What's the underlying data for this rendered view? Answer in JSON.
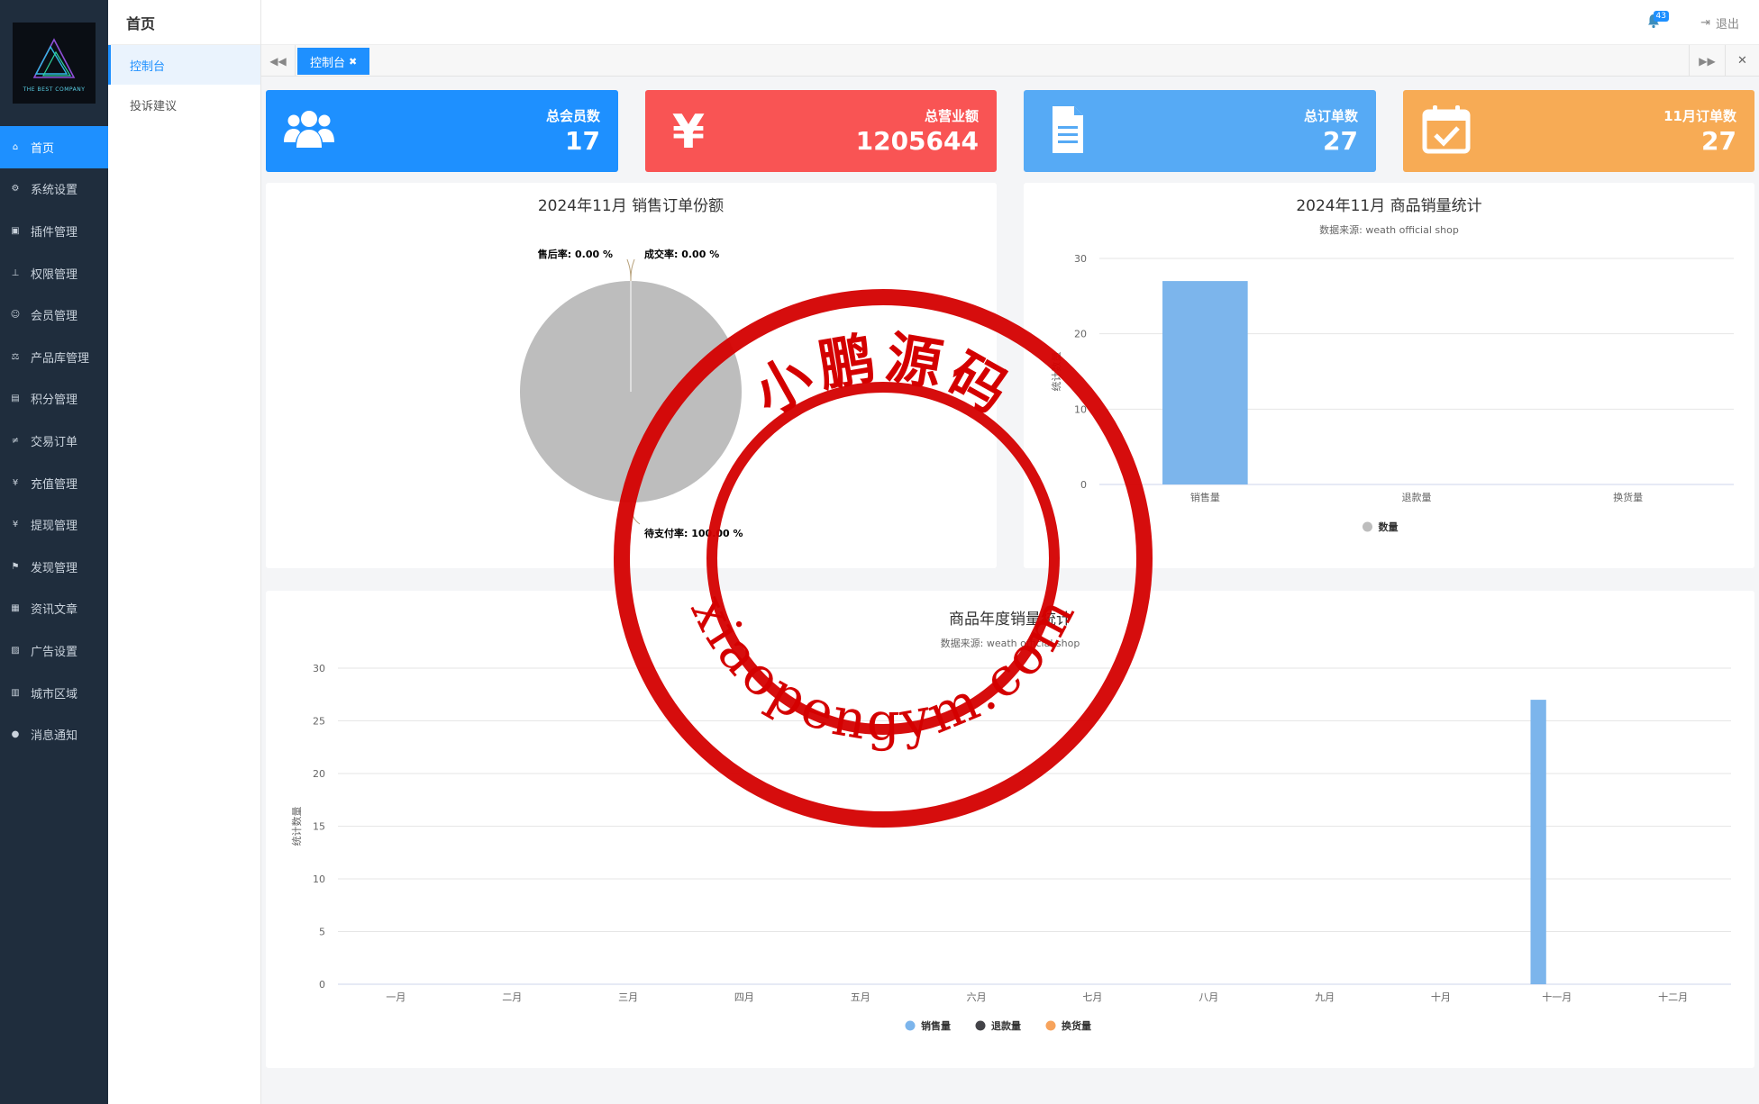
{
  "sidebar": {
    "logo_text": "THE BEST COMPANY",
    "items": [
      {
        "label": "首页",
        "icon": "home-icon",
        "active": true
      },
      {
        "label": "系统设置",
        "icon": "gear-icon"
      },
      {
        "label": "插件管理",
        "icon": "plugin-icon"
      },
      {
        "label": "权限管理",
        "icon": "sitemap-icon"
      },
      {
        "label": "会员管理",
        "icon": "users-icon"
      },
      {
        "label": "产品库管理",
        "icon": "scale-icon"
      },
      {
        "label": "积分管理",
        "icon": "file-icon"
      },
      {
        "label": "交易订单",
        "icon": "yen-lines-icon"
      },
      {
        "label": "充值管理",
        "icon": "yen-icon"
      },
      {
        "label": "提现管理",
        "icon": "yen-icon"
      },
      {
        "label": "发现管理",
        "icon": "flag-icon"
      },
      {
        "label": "资讯文章",
        "icon": "newspaper-icon"
      },
      {
        "label": "广告设置",
        "icon": "image-icon"
      },
      {
        "label": "城市区域",
        "icon": "map-icon"
      },
      {
        "label": "消息通知",
        "icon": "comment-icon"
      }
    ]
  },
  "subbar": {
    "title": "首页",
    "items": [
      {
        "label": "控制台",
        "active": true
      },
      {
        "label": "投诉建议"
      }
    ]
  },
  "header": {
    "notify_count": "43",
    "logout_label": "退出"
  },
  "tabs": [
    {
      "label": "控制台",
      "close": "✖"
    }
  ],
  "stats": [
    {
      "label": "总会员数",
      "value": "17",
      "color": "#1e90ff",
      "icon": "users-icon"
    },
    {
      "label": "总营业额",
      "value": "1205644",
      "color": "#f95454",
      "icon": "yen-icon"
    },
    {
      "label": "总订单数",
      "value": "27",
      "color": "#56aaf5",
      "icon": "document-icon"
    },
    {
      "label": "11月订单数",
      "value": "27",
      "color": "#f7ab55",
      "icon": "calendar-check-icon"
    }
  ],
  "chart_data": [
    {
      "type": "pie",
      "title": "2024年11月 销售订单份额",
      "slices": [
        {
          "name": "售后率",
          "value": 0.0,
          "label": "售后率: 0.00 %"
        },
        {
          "name": "成交率",
          "value": 0.0,
          "label": "成交率: 0.00 %"
        },
        {
          "name": "待支付率",
          "value": 100.0,
          "label": "待支付率: 100.00 %"
        }
      ],
      "colors": [
        "#7cb5ec",
        "#434348",
        "#bdbdbd"
      ]
    },
    {
      "type": "bar",
      "title": "2024年11月 商品销量统计",
      "subtitle": "数据来源: weath official shop",
      "ylabel": "统计数量",
      "categories": [
        "销售量",
        "退款量",
        "换货量"
      ],
      "series": [
        {
          "name": "数量",
          "values": [
            27,
            0,
            0
          ]
        }
      ],
      "ylim": [
        0,
        30
      ],
      "yticks": [
        0,
        10,
        20,
        30
      ],
      "legend_color": "#bdbdbd",
      "bar_color": "#7cb5ec",
      "legend": "bottom"
    },
    {
      "type": "bar",
      "title": "商品年度销量统计",
      "subtitle": "数据来源: weath official shop",
      "ylabel": "统计数量",
      "categories": [
        "一月",
        "二月",
        "三月",
        "四月",
        "五月",
        "六月",
        "七月",
        "八月",
        "九月",
        "十月",
        "十一月",
        "十二月"
      ],
      "series": [
        {
          "name": "销售量",
          "values": [
            0,
            0,
            0,
            0,
            0,
            0,
            0,
            0,
            0,
            0,
            27,
            0
          ],
          "color": "#7cb5ec"
        },
        {
          "name": "退款量",
          "values": [
            0,
            0,
            0,
            0,
            0,
            0,
            0,
            0,
            0,
            0,
            0,
            0
          ],
          "color": "#434348"
        },
        {
          "name": "换货量",
          "values": [
            0,
            0,
            0,
            0,
            0,
            0,
            0,
            0,
            0,
            0,
            0,
            0
          ],
          "color": "#f7a35c"
        }
      ],
      "ylim": [
        0,
        30
      ],
      "yticks": [
        0,
        5,
        10,
        15,
        20,
        25,
        30
      ],
      "legend": "bottom"
    }
  ],
  "watermark": {
    "top_text": "小鹏源码",
    "bottom_text": "xiaopengym.com",
    "color": "#d40000"
  }
}
